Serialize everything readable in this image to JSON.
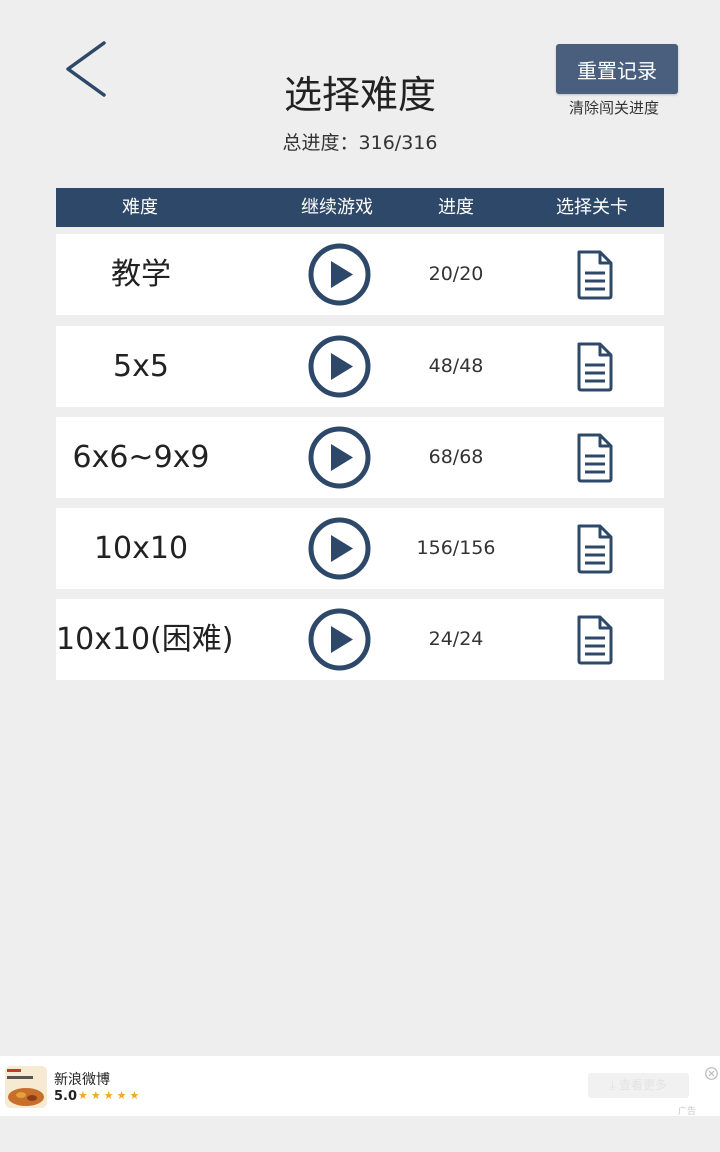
{
  "header": {
    "back_icon": "chevron-left-icon",
    "title": "选择难度",
    "total_progress": "总进度：316/316",
    "reset_button": "重置记录",
    "reset_hint": "清除闯关进度"
  },
  "table": {
    "columns": [
      "难度",
      "继续游戏",
      "进度",
      "选择关卡"
    ],
    "rows": [
      {
        "name": "教学",
        "progress": "20/20",
        "play_icon": "play-circle-icon",
        "select_icon": "document-icon"
      },
      {
        "name": "5x5",
        "progress": "48/48",
        "play_icon": "play-circle-icon",
        "select_icon": "document-icon"
      },
      {
        "name": "6x6~9x9",
        "progress": "68/68",
        "play_icon": "play-circle-icon",
        "select_icon": "document-icon"
      },
      {
        "name": "10x10",
        "progress": "156/156",
        "play_icon": "play-circle-icon",
        "select_icon": "document-icon"
      },
      {
        "name": "10x10(困难)",
        "progress": "24/24",
        "play_icon": "play-circle-icon",
        "select_icon": "document-icon"
      }
    ]
  },
  "ad": {
    "app_name": "新浪微博",
    "rating": "5.0",
    "stars": 5,
    "cta": "⤓ 查看更多",
    "tag": "广告",
    "close_icon": "close-circle-icon"
  },
  "colors": {
    "accent": "#2e4869",
    "button": "#4a5f7e",
    "background": "#eeeeee",
    "row_background": "#ffffff"
  }
}
